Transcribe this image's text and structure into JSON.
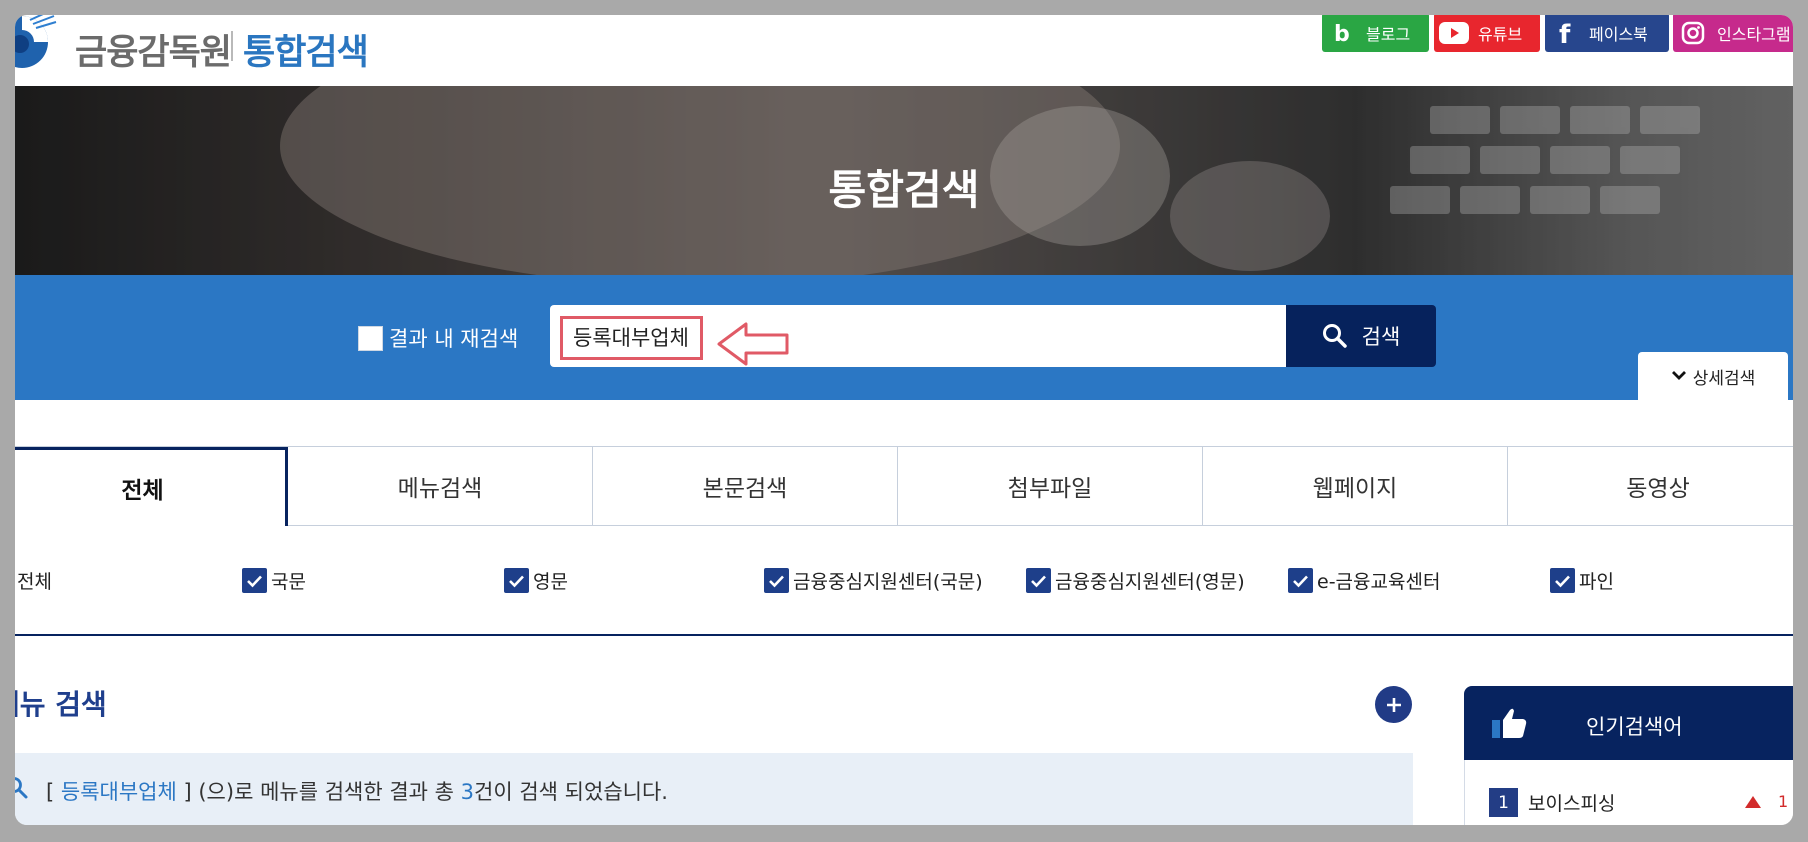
{
  "header": {
    "logo_text": "금융감독원",
    "logo_sub": "통합검색",
    "social": [
      {
        "label": "블로그",
        "icon": "blog-icon",
        "color": "#2aa644"
      },
      {
        "label": "유튜브",
        "icon": "youtube-icon",
        "color": "#e8262e"
      },
      {
        "label": "페이스북",
        "icon": "facebook-icon",
        "color": "#27468d"
      },
      {
        "label": "인스타그램",
        "icon": "instagram-icon",
        "color": "#c62a8c"
      }
    ]
  },
  "hero": {
    "title": "통합검색"
  },
  "search": {
    "research_label": "결과 내 재검색",
    "value": "등록대부업체",
    "button_label": "검색",
    "detail_label": "상세검색"
  },
  "tabs": [
    "전체",
    "메뉴검색",
    "본문검색",
    "첨부파일",
    "웹페이지",
    "동영상"
  ],
  "filters": [
    "전체",
    "국문",
    "영문",
    "금융중심지원센터(국문)",
    "금융중심지원센터(영문)",
    "e-금융교육센터",
    "파인"
  ],
  "menu_search": {
    "title": "메뉴 검색",
    "result_open": "[",
    "result_keyword": "등록대부업체",
    "result_mid": "] (으)로 메뉴를 검색한 결과 총",
    "result_count": "3",
    "result_tail": "건이 검색 되었습니다."
  },
  "popular": {
    "title": "인기검색어",
    "items": [
      {
        "rank": "1",
        "term": "보이스피싱",
        "change": "1"
      }
    ]
  },
  "colors": {
    "primary": "#2b77c4",
    "navy": "#07235f",
    "highlight": "#e05a66"
  }
}
